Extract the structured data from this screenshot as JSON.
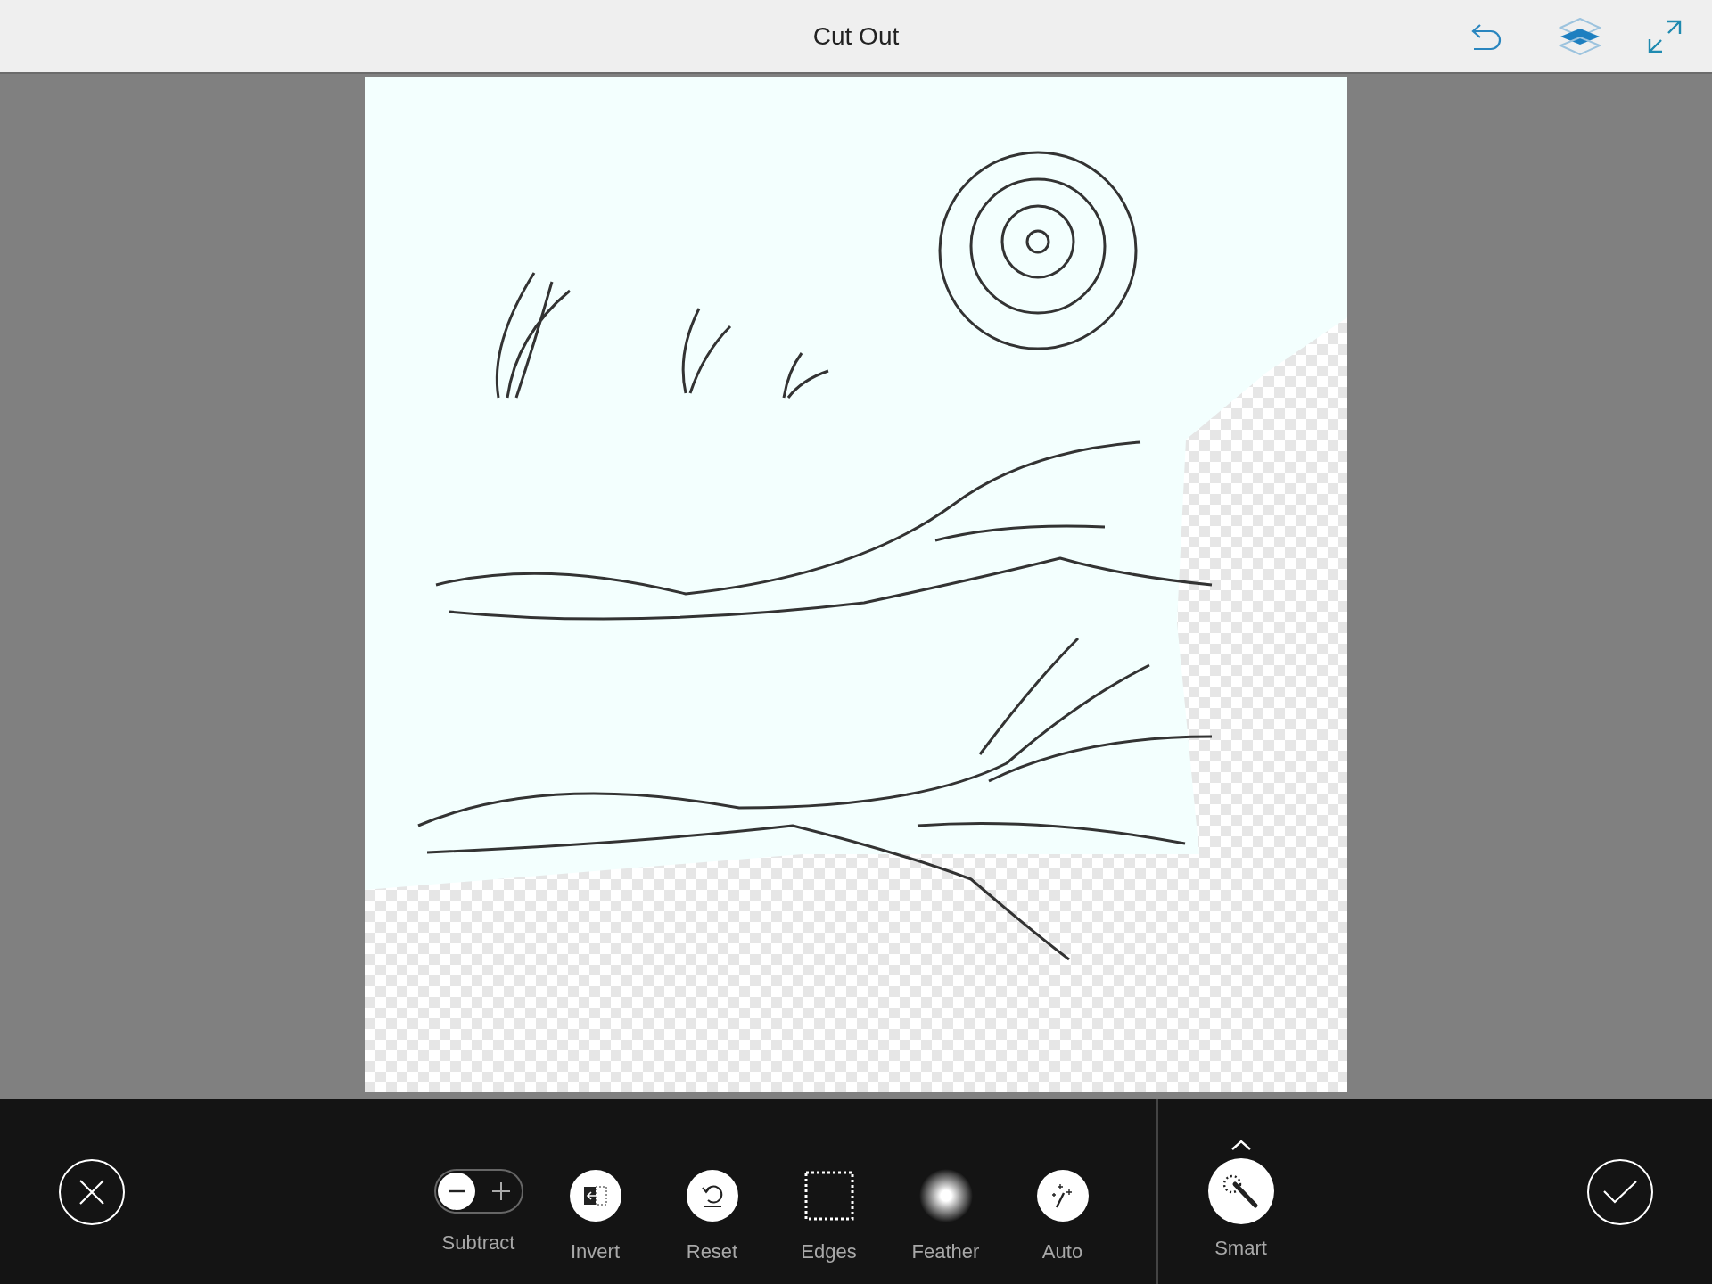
{
  "window": {
    "title": "Cut Out"
  },
  "tools": [
    {
      "kind": "toggle",
      "label": "Subtract",
      "subtract_on": true
    },
    {
      "kind": "invert",
      "label": "Invert"
    },
    {
      "kind": "reset",
      "label": "Reset"
    },
    {
      "kind": "edges",
      "label": "Edges"
    },
    {
      "kind": "feather",
      "label": "Feather"
    },
    {
      "kind": "auto",
      "label": "Auto"
    }
  ],
  "smart": {
    "label": "Smart"
  }
}
